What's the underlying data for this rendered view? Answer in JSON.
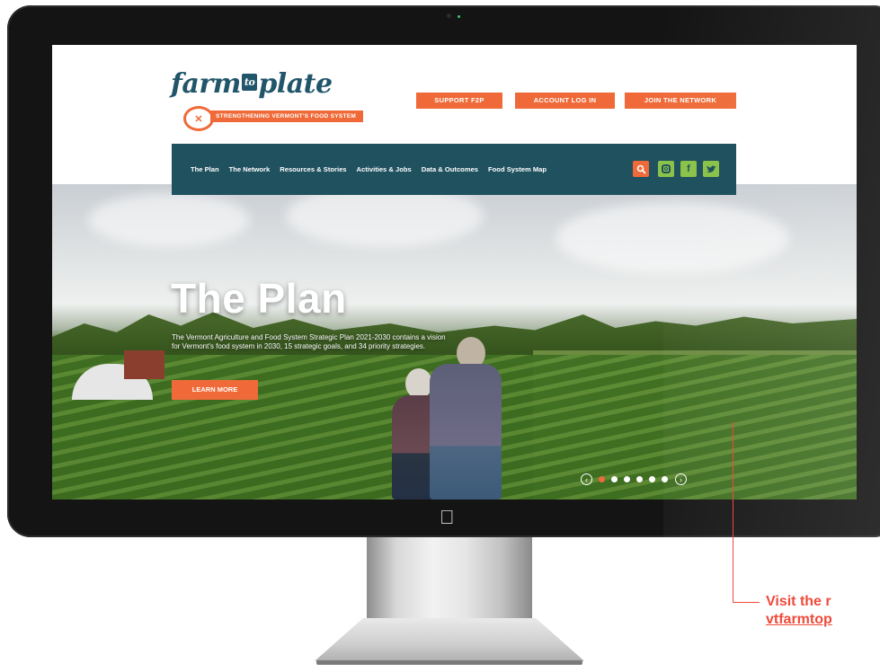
{
  "logo": {
    "word_left": "farm",
    "word_mid": "to",
    "word_right": "plate",
    "tagline": "STRENGTHENING VERMONT'S FOOD SYSTEM"
  },
  "top_buttons": {
    "support": "SUPPORT F2P",
    "login": "ACCOUNT LOG IN",
    "join": "JOIN THE NETWORK"
  },
  "nav": {
    "items": [
      {
        "label": "The Plan"
      },
      {
        "label": "The Network"
      },
      {
        "label": "Resources & Stories"
      },
      {
        "label": "Activities & Jobs"
      },
      {
        "label": "Data & Outcomes"
      },
      {
        "label": "Food System Map"
      }
    ],
    "icons": [
      "search-icon",
      "instagram-icon",
      "facebook-icon",
      "twitter-icon"
    ]
  },
  "hero": {
    "title": "The Plan",
    "description": "The Vermont Agriculture and Food System Strategic Plan 2021-2030 contains a vision for Vermont's food system in 2030, 15 strategic goals, and 34 priority strategies.",
    "button": "LEARN MORE"
  },
  "carousel": {
    "slide_count": 7,
    "active_index": 0
  },
  "callout": {
    "line1": "Visit the r",
    "line2": "vtfarmtop"
  },
  "colors": {
    "accent_orange": "#ef6a38",
    "nav_teal": "#20515f",
    "social_green": "#8bc34a",
    "callout_red": "#ef4a3a"
  }
}
